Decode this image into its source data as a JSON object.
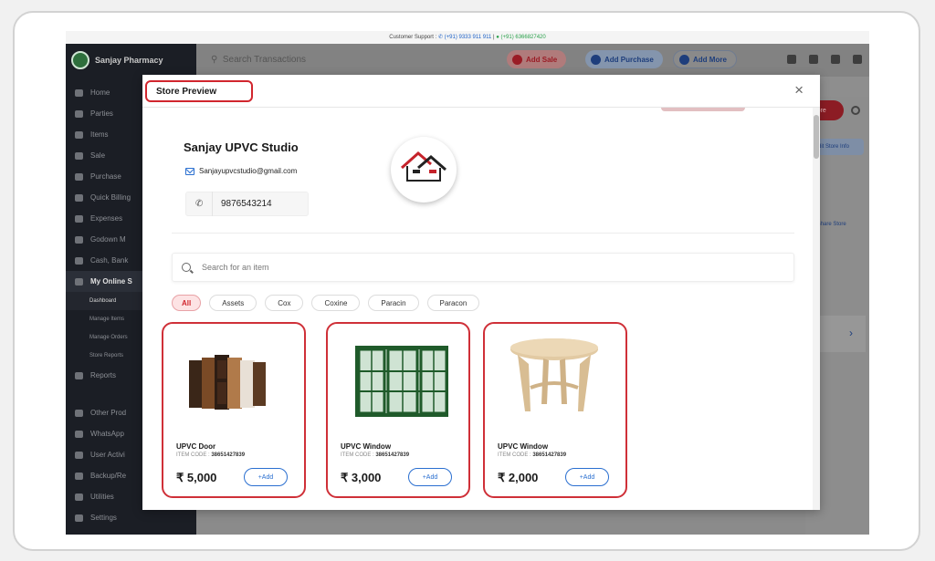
{
  "support_bar": {
    "label": "Customer Support :",
    "phone": "(+91) 9333 911 911",
    "separator": "|",
    "whatsapp": "(+91) 6366827420"
  },
  "sidebar": {
    "business_name": "Sanjay Pharmacy",
    "items": [
      {
        "label": "Home"
      },
      {
        "label": "Parties"
      },
      {
        "label": "Items"
      },
      {
        "label": "Sale"
      },
      {
        "label": "Purchase"
      },
      {
        "label": "Quick Billing"
      },
      {
        "label": "Expenses"
      },
      {
        "label": "Godown M"
      },
      {
        "label": "Cash, Bank"
      },
      {
        "label": "My Online S"
      }
    ],
    "online_store_sub": [
      "Dashboard",
      "Manage Items",
      "Manage Orders",
      "Store Reports"
    ],
    "items_bottom": [
      {
        "label": "Reports"
      },
      {
        "label": "Other Prod"
      },
      {
        "label": "WhatsApp"
      },
      {
        "label": "User Activi"
      },
      {
        "label": "Backup/Re"
      },
      {
        "label": "Utilities"
      },
      {
        "label": "Settings"
      }
    ]
  },
  "topbar": {
    "search_placeholder": "Search Transactions",
    "add_sale": "Add Sale",
    "add_purchase": "Add Purchase",
    "add_more": "Add More"
  },
  "background_right": {
    "store_btn": "Store",
    "edit_store_info": "Edit Store Info",
    "share_store": "Share Store",
    "chevron": "›"
  },
  "modal": {
    "title": "Store Preview",
    "close": "×",
    "store": {
      "name": "Sanjay UPVC Studio",
      "email": "Sanjayupvcstudio@gmail.com",
      "phone": "9876543214"
    },
    "search_placeholder": "Search for an item",
    "categories": [
      "All",
      "Assets",
      "Cox",
      "Coxine",
      "Paracin",
      "Paracon"
    ],
    "active_category": "All",
    "products": [
      {
        "name": "UPVC Door",
        "code_label": "ITEM CODE :",
        "code": "38651427839",
        "price": "₹ 5,000",
        "add_label": "+Add"
      },
      {
        "name": "UPVC Window",
        "code_label": "ITEM CODE :",
        "code": "38651427839",
        "price": "₹ 3,000",
        "add_label": "+Add"
      },
      {
        "name": "UPVC Window",
        "code_label": "ITEM CODE :",
        "code": "38651427839",
        "price": "₹ 2,000",
        "add_label": "+Add"
      }
    ]
  },
  "colors": {
    "brand_red": "#d1262e",
    "link_blue": "#2a6fd0",
    "sidebar_dark": "#1b1e25"
  }
}
